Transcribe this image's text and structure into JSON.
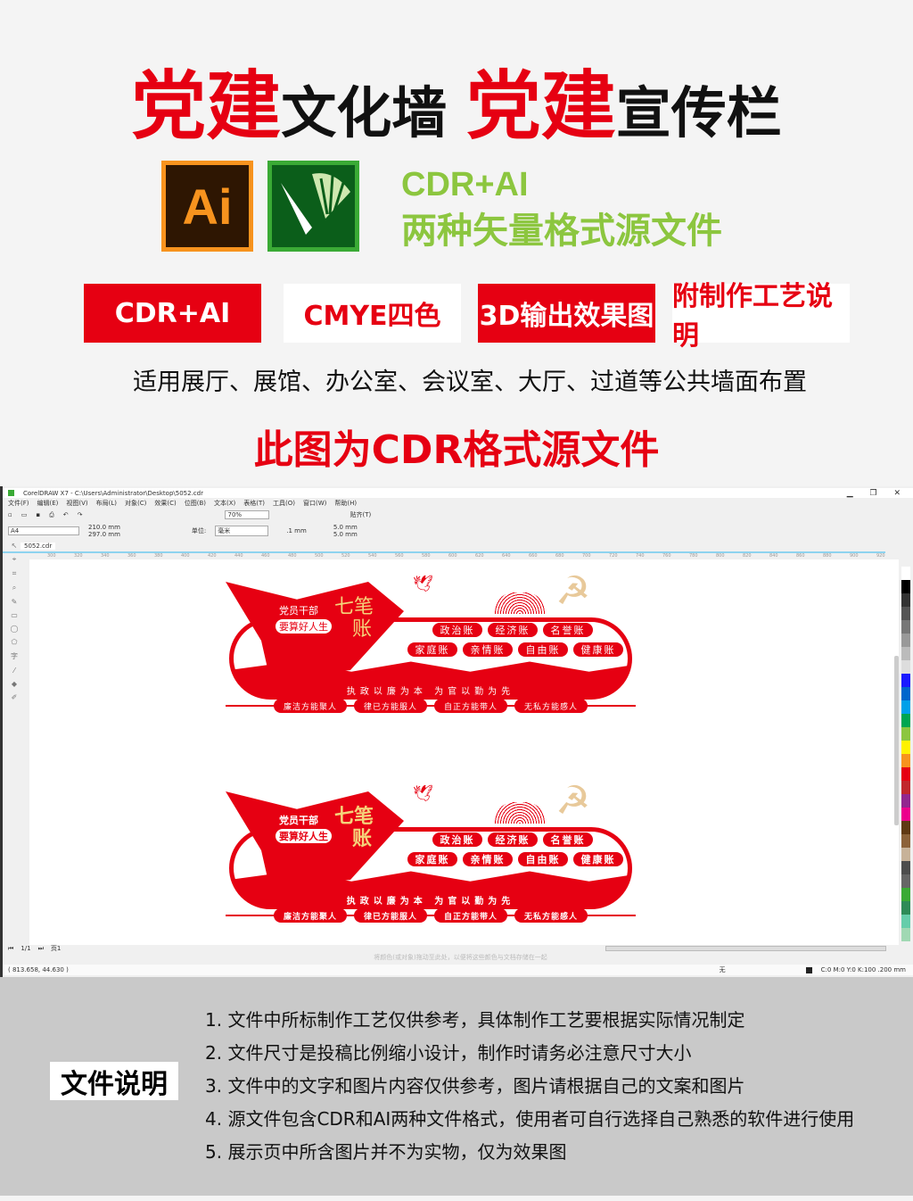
{
  "header": {
    "t1": "党建",
    "t2": "文化墙 ",
    "t3": "党建",
    "t4": "宣传栏"
  },
  "logos": {
    "ai_text": "Ai",
    "ai_icon": "illustrator-logo",
    "cdr_icon": "coreldraw-logo"
  },
  "formats": {
    "line1": "CDR+AI",
    "line2": "两种矢量格式源文件"
  },
  "badges": [
    "CDR+AI",
    "CMYE四色",
    "3D输出效果图",
    "附制作工艺说明"
  ],
  "usage": "适用展厅、展馆、办公室、会议室、大厅、过道等公共墙面布置",
  "source_note": "此图为CDR格式源文件",
  "colors": {
    "red": "#e60012",
    "green": "#8cc63f",
    "gold": "#e8c99a"
  },
  "app": {
    "title": "CorelDRAW X7 - C:\\Users\\Administrator\\Desktop\\5052.cdr",
    "menu": [
      "文件(F)",
      "编辑(E)",
      "视图(V)",
      "布局(L)",
      "对象(C)",
      "效果(C)",
      "位图(B)",
      "文本(X)",
      "表格(T)",
      "工具(O)",
      "窗口(W)",
      "帮助(H)"
    ],
    "zoom": "70%",
    "snap": "贴齐(T)",
    "page_size": "A4",
    "width": "210.0 mm",
    "height": "297.0 mm",
    "unit_label": "单位:",
    "unit": "毫米",
    "nudge": ".1 mm",
    "dup_x": "5.0 mm",
    "dup_y": "5.0 mm",
    "tab": "5052.cdr",
    "ruler": [
      "300",
      "320",
      "340",
      "360",
      "380",
      "400",
      "420",
      "440",
      "460",
      "480",
      "500",
      "520",
      "540",
      "560",
      "580",
      "600",
      "620",
      "640",
      "660",
      "680",
      "700",
      "720",
      "740",
      "760",
      "780",
      "800",
      "820",
      "840",
      "860",
      "880",
      "900",
      "920"
    ],
    "page_nav": "1/1",
    "page_tab": "页1",
    "hint": "将颜色(或对象)拖动至此处，以便将这些颜色与文档存储在一起",
    "coords": "( 813.658, 44.630 )",
    "fill": "无",
    "color_info": "C:0 M:0 Y:0 K:100  .200 mm"
  },
  "design": {
    "flag_top": "党员干部",
    "flag_pill": "要算好人生",
    "big1": "七笔",
    "big2": "账",
    "row1": [
      "政治账",
      "经济账",
      "名誉账"
    ],
    "row2": [
      "家庭账",
      "亲情账",
      "自由账",
      "健康账"
    ],
    "motto": "执政以廉为本    为官以勤为先",
    "row3": [
      "廉洁方能聚人",
      "律已方能服人",
      "自正方能带人",
      "无私方能感人"
    ]
  },
  "notes": {
    "label": "文件说明",
    "items": [
      "1. 文件中所标制作工艺仅供参考，具体制作工艺要根据实际情况制定",
      "2. 文件尺寸是投稿比例缩小设计，制作时请务必注意尺寸大小",
      "3. 文件中的文字和图片内容仅供参考，图片请根据自己的文案和图片",
      "4. 源文件包含CDR和AI两种文件格式，使用者可自行选择自己熟悉的软件进行使用",
      "5. 展示页中所含图片并不为实物，仅为效果图"
    ]
  }
}
